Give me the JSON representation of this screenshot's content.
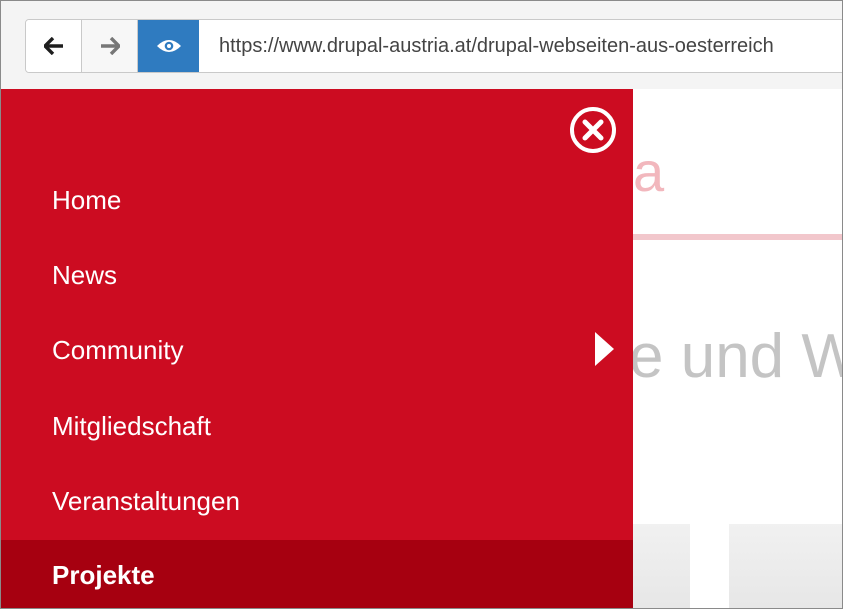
{
  "browser": {
    "url": "https://www.drupal-austria.at/drupal-webseiten-aus-oesterreich",
    "icons": {
      "back": "arrow-left-icon",
      "forward": "arrow-right-icon",
      "view": "eye-icon"
    }
  },
  "page": {
    "logo_fragment": "a",
    "heading_fragment": "e und W"
  },
  "menu": {
    "close_icon": "close-circle-icon",
    "items": [
      {
        "label": "Home"
      },
      {
        "label": "News"
      },
      {
        "label": "Community",
        "has_submenu": true
      },
      {
        "label": "Mitgliedschaft"
      },
      {
        "label": "Veranstaltungen"
      },
      {
        "label": "Projekte",
        "active": true
      }
    ]
  },
  "colors": {
    "menu_bg": "#cc0c21",
    "menu_active_bg": "#a60010",
    "view_button": "#2f7bc0"
  }
}
